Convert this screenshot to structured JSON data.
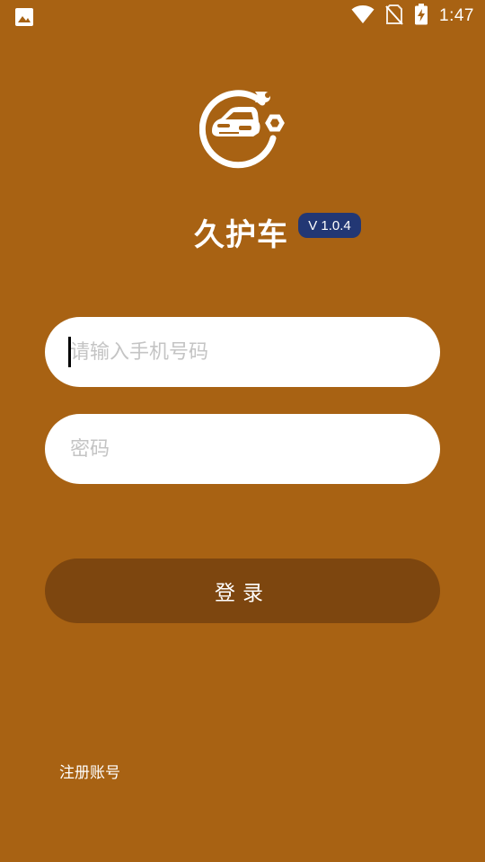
{
  "status_bar": {
    "time": "1:47",
    "icons": [
      "image-icon",
      "wifi-icon",
      "no-sim-icon",
      "battery-charging-icon"
    ]
  },
  "app": {
    "name": "久护车",
    "version": "V 1.0.4",
    "logo_icon": "car-wrench-logo-icon"
  },
  "form": {
    "phone_placeholder": "请输入手机号码",
    "phone_value": "",
    "password_placeholder": "密码",
    "password_value": "",
    "login_label": "登录",
    "register_label": "注册账号"
  },
  "colors": {
    "background": "#a86213",
    "button": "#7d460f",
    "badge": "#223774",
    "field": "#ffffff"
  }
}
